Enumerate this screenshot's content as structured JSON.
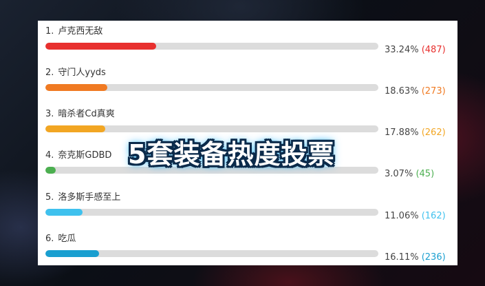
{
  "overlay_title": "5套装备热度投票",
  "poll": {
    "items": [
      {
        "index": "1.",
        "label": "卢克西无敌",
        "percent_text": "33.24%",
        "count_text": "(487)",
        "fraction": 0.3324,
        "color": "#e8302e"
      },
      {
        "index": "2.",
        "label": "守门人yyds",
        "percent_text": "18.63%",
        "count_text": "(273)",
        "fraction": 0.1863,
        "color": "#f07a22"
      },
      {
        "index": "3.",
        "label": "暗杀者Cd真爽",
        "percent_text": "17.88%",
        "count_text": "(262)",
        "fraction": 0.1788,
        "color": "#f2a623"
      },
      {
        "index": "4.",
        "label": "奈克斯GDBD",
        "percent_text": "3.07%",
        "count_text": "(45)",
        "fraction": 0.0307,
        "color": "#4caf50"
      },
      {
        "index": "5.",
        "label": "洛多斯手感至上",
        "percent_text": "11.06%",
        "count_text": "(162)",
        "fraction": 0.1106,
        "color": "#3fc1ee"
      },
      {
        "index": "6.",
        "label": "吃瓜",
        "percent_text": "16.11%",
        "count_text": "(236)",
        "fraction": 0.1611,
        "color": "#1a9fd0"
      }
    ]
  }
}
